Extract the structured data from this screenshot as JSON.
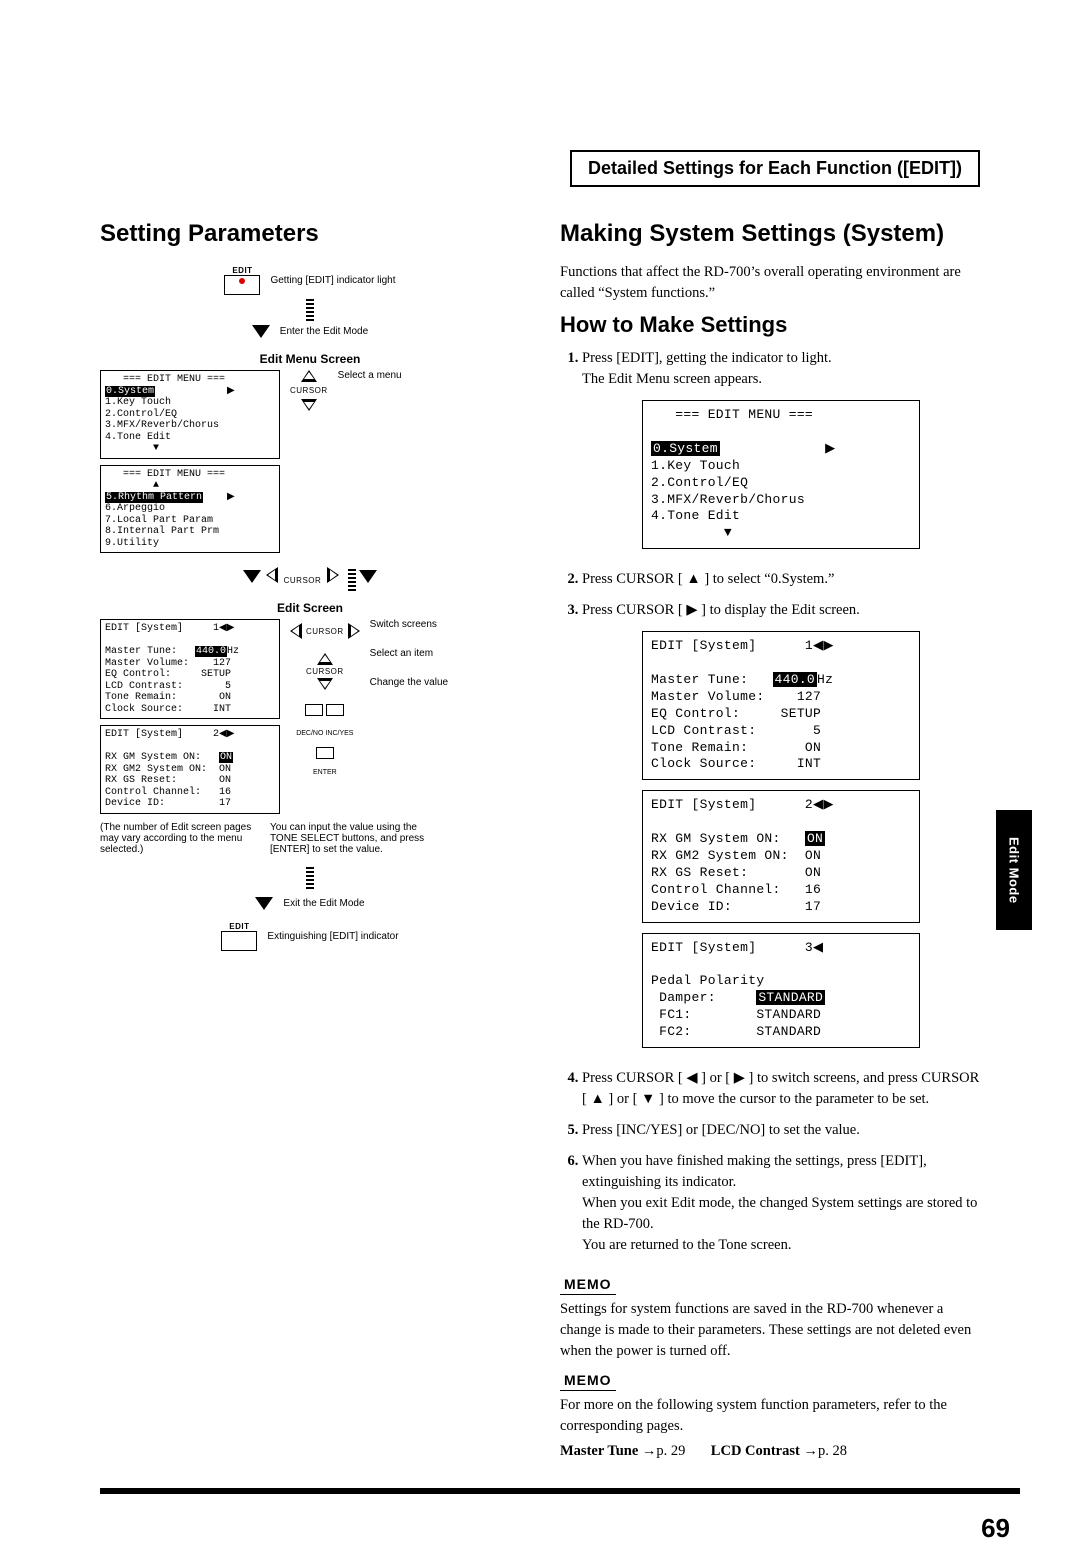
{
  "header": {
    "title": "Detailed Settings for Each Function ([EDIT])"
  },
  "sideTab": "Edit Mode",
  "pageNumber": "69",
  "left": {
    "heading": "Setting Parameters",
    "editButtonLabel": "EDIT",
    "step1a": "Getting [EDIT] indicator light",
    "step1b": "Enter the Edit Mode",
    "editMenuTitle": "Edit Menu Screen",
    "menuA": "   === EDIT MENU ===\n0.System\n1.Key Touch\n2.Control/EQ\n3.MFX/Reverb/Chorus\n4.Tone Edit",
    "menuA_sel": "0.System",
    "menuA_scrollDown": "▼",
    "menuB": "   === EDIT MENU ===\n        ▲\n5.Rhythm Pattern\n6.Arpeggio\n7.Local Part Param\n8.Internal Part Prm\n9.Utility",
    "menuB_sel": "5.Rhythm Pattern",
    "selectMenu": "Select a menu",
    "cursorWord": "CURSOR",
    "editScreenTitle": "Edit Screen",
    "switchScreens": "Switch screens",
    "selectItem": "Select an item",
    "changeValue": "Change the value",
    "decno": "DEC/NO",
    "incyes": "INC/YES",
    "enter": "ENTER",
    "noteValue": "You can input the value using the TONE SELECT buttons, and press [ENTER] to set the value.",
    "noteLeft": "(The number of Edit screen pages may vary according to the menu selected.)",
    "exit": "Exit the Edit Mode",
    "exting": "Extinguishing [EDIT] indicator",
    "es1": "EDIT [System]     1◀▶",
    "es1b": "Master Tune:   440.0Hz\nMaster Volume:    127\nEQ Control:     SETUP\nLCD Contrast:       5\nTone Remain:       ON\nClock Source:     INT",
    "es1_hl": "440.0",
    "es2": "EDIT [System]     2◀▶",
    "es2b": "RX GM System ON:   ON\nRX GM2 System ON:  ON\nRX GS Reset:       ON\nControl Channel:   16\nDevice ID:         17",
    "es2_hl": "ON"
  },
  "right": {
    "heading1": "Making System Settings (System)",
    "intro": "Functions that affect the RD-700’s overall operating environment are called “System functions.”",
    "heading2": "How to Make Settings",
    "step1": "Press [EDIT], getting the indicator to light.",
    "step1b": "The Edit Menu screen appears.",
    "lcdMenuTitle": "   === EDIT MENU ===",
    "lcdMenuRows": "0.System\n1.Key Touch\n2.Control/EQ\n3.MFX/Reverb/Chorus\n4.Tone Edit\n        ▼",
    "lcdMenu_sel": "0.System",
    "step2": "Press CURSOR [ ▲ ] to select “0.System.”",
    "step3": "Press CURSOR [ ▶ ] to display the Edit screen.",
    "lcdS1Title": "EDIT [System]      1◀▶",
    "lcdS1Body": "Master Tune:   440.0Hz\nMaster Volume:    127\nEQ Control:     SETUP\nLCD Contrast:       5\nTone Remain:       ON\nClock Source:     INT",
    "lcdS1_hl": "440.0",
    "lcdS2Title": "EDIT [System]      2◀▶",
    "lcdS2Body": "RX GM System ON:   ON\nRX GM2 System ON:  ON\nRX GS Reset:       ON\nControl Channel:   16\nDevice ID:         17",
    "lcdS2_hl": "ON",
    "lcdS3Title": "EDIT [System]      3◀ ",
    "lcdS3Body": "Pedal Polarity\n Damper:     STANDARD\n FC1:        STANDARD\n FC2:        STANDARD",
    "lcdS3_hl": "STANDARD",
    "step4": "Press CURSOR [ ◀ ] or [ ▶ ] to switch screens, and press CURSOR [ ▲ ] or [ ▼ ] to move the cursor to the parameter to be set.",
    "step5": "Press [INC/YES] or [DEC/NO] to set the value.",
    "step6a": "When you have finished making the settings, press [EDIT], extinguishing its indicator.",
    "step6b": "When you exit Edit mode, the changed System settings are stored to the RD-700.",
    "step6c": "You are returned to the Tone screen.",
    "memoLabel": "MEMO",
    "memo1": "Settings for system functions are saved in the RD-700 whenever a change is made to their parameters. These settings are not deleted even when the power is turned off.",
    "memo2": "For more on the following system function parameters, refer to the corresponding pages.",
    "ref1Label": "Master Tune →",
    "ref1Page": "p. 29",
    "ref2Label": "LCD Contrast →",
    "ref2Page": "p. 28"
  }
}
